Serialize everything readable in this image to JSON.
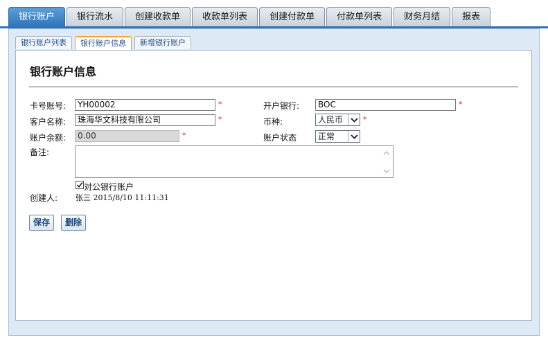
{
  "top_tabs": [
    {
      "label": "银行账户",
      "active": true
    },
    {
      "label": "银行流水",
      "active": false
    },
    {
      "label": "创建收款单",
      "active": false
    },
    {
      "label": "收款单列表",
      "active": false
    },
    {
      "label": "创建付款单",
      "active": false
    },
    {
      "label": "付款单列表",
      "active": false
    },
    {
      "label": "财务月结",
      "active": false
    },
    {
      "label": "报表",
      "active": false
    }
  ],
  "sub_tabs": [
    {
      "label": "银行账户列表",
      "active": false
    },
    {
      "label": "银行账户信息",
      "active": true
    },
    {
      "label": "新增银行账户",
      "active": false
    }
  ],
  "page_title": "银行账户信息",
  "form": {
    "card_no": {
      "label": "卡号账号:",
      "value": "YH00002",
      "required": "*"
    },
    "customer_name": {
      "label": "客户名称:",
      "value": "珠海华文科技有限公司",
      "required": "*"
    },
    "balance": {
      "label": "账户余额:",
      "value": "0.00",
      "required": "*"
    },
    "remark": {
      "label": "备注:",
      "value": ""
    },
    "bank": {
      "label": "开户银行:",
      "value": "BOC",
      "required": "*"
    },
    "currency": {
      "label": "币种:",
      "value": "人民币",
      "required": "*"
    },
    "status": {
      "label": "账户状态",
      "value": "正常"
    },
    "corporate_account": {
      "label": "对公银行账户",
      "checked": true
    },
    "creator": {
      "label": "创建人:",
      "value": "张三 2015/8/10 11:11:31"
    }
  },
  "buttons": {
    "save": "保存",
    "delete": "删除"
  },
  "colors": {
    "active_tab": "#2e73b8",
    "panel_bg": "#dde9f5",
    "required": "#e0201c",
    "button_text": "#1d4b82"
  }
}
